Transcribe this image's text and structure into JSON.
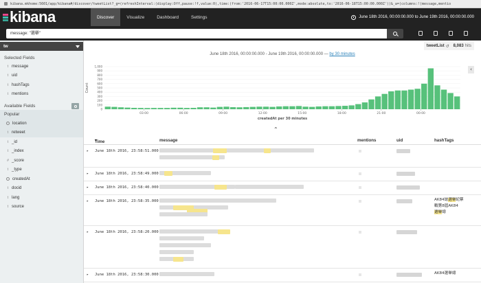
{
  "browser": {
    "url": "kibana.mkhome:5601/app/kibana#/discover/tweetList?_g=(refreshInterval:(display:Off,pause:!f,value:0),time:(from:'2016-06-17T15:00:00.000Z',mode:absolute,to:'2016-06-18T15:00:00.000Z'))&_a=(columns:!(message,mentio"
  },
  "brand": {
    "name": "kibana",
    "logo_colors": [
      "#e8478b",
      "#3ebeb0",
      "#37a595"
    ]
  },
  "nav": {
    "tabs": [
      {
        "label": "Discover",
        "active": true
      },
      {
        "label": "Visualize",
        "active": false
      },
      {
        "label": "Dashboard",
        "active": false
      },
      {
        "label": "Settings",
        "active": false
      }
    ],
    "time_range": "June 18th 2016, 00:00:00.000 to June 19th 2016, 00:00:00.000"
  },
  "query": {
    "value": "message: \"選舉\""
  },
  "sidebar": {
    "index": "tw",
    "selected_heading": "Selected Fields",
    "selected_fields": [
      {
        "type": "t",
        "name": "message"
      },
      {
        "type": "t",
        "name": "uid"
      },
      {
        "type": "t",
        "name": "hashTags"
      },
      {
        "type": "t",
        "name": "mentions"
      }
    ],
    "available_heading": "Available Fields",
    "popular_label": "Popular",
    "popular_fields": [
      {
        "type": "geo",
        "name": "location"
      },
      {
        "type": "t",
        "name": "retweet"
      }
    ],
    "other_fields": [
      {
        "type": "t",
        "name": "_id"
      },
      {
        "type": "t",
        "name": "_index"
      },
      {
        "type": "#",
        "name": "_score"
      },
      {
        "type": "t",
        "name": "_type"
      },
      {
        "type": "clock",
        "name": "createdAt"
      },
      {
        "type": "t",
        "name": "docid"
      },
      {
        "type": "t",
        "name": "lang"
      },
      {
        "type": "t",
        "name": "source"
      }
    ]
  },
  "hits": {
    "search_name": "tweetList",
    "count": "8,083",
    "label": "hits"
  },
  "time_header": {
    "range": "June 18th 2016, 00:00:00.000 - June 19th 2016, 00:00:00.000 —",
    "interval_link": "by 30 minutes"
  },
  "chart_data": {
    "type": "bar",
    "ylabel": "Count",
    "xlabel": "createdAt per 30 minutes",
    "ylim": [
      0,
      1000
    ],
    "y_ticks": [
      "0",
      "100",
      "200",
      "300",
      "400",
      "500",
      "600",
      "700",
      "800",
      "900",
      "1,000"
    ],
    "x_ticks": [
      "03:00",
      "06:00",
      "09:00",
      "12:00",
      "15:00",
      "18:00",
      "21:00",
      "00:00"
    ],
    "bar_color": "#57c17b",
    "values": [
      60,
      55,
      45,
      38,
      32,
      30,
      28,
      30,
      30,
      30,
      35,
      35,
      30,
      32,
      45,
      45,
      38,
      55,
      60,
      48,
      45,
      50,
      55,
      60,
      60,
      55,
      65,
      70,
      70,
      75,
      60,
      55,
      65,
      70,
      70,
      75,
      80,
      90,
      120,
      160,
      230,
      300,
      360,
      420,
      440,
      440,
      460,
      480,
      600,
      960,
      560,
      460,
      380,
      300
    ]
  },
  "table": {
    "columns": [
      "Time",
      "message",
      "mentions",
      "uid",
      "hashTags"
    ],
    "rows": [
      {
        "time": "June 18th 2016, 23:58:51.000",
        "tags": []
      },
      {
        "time": "June 18th 2016, 23:58:49.000",
        "tags": []
      },
      {
        "time": "June 18th 2016, 23:58:40.000",
        "tags": []
      },
      {
        "time": "June 18th 2016, 23:58:35.000",
        "tags": [
          "AK84誌",
          "選舉",
          "紀",
          "蔡",
          "戰",
          "第8屆AK84",
          "選舉",
          "總"
        ]
      },
      {
        "time": "June 18th 2016, 23:58:20.000",
        "tags": []
      },
      {
        "time": "June 18th 2016, 23:58:30.000",
        "tags": [
          "AK84選舉",
          "總"
        ]
      }
    ]
  }
}
